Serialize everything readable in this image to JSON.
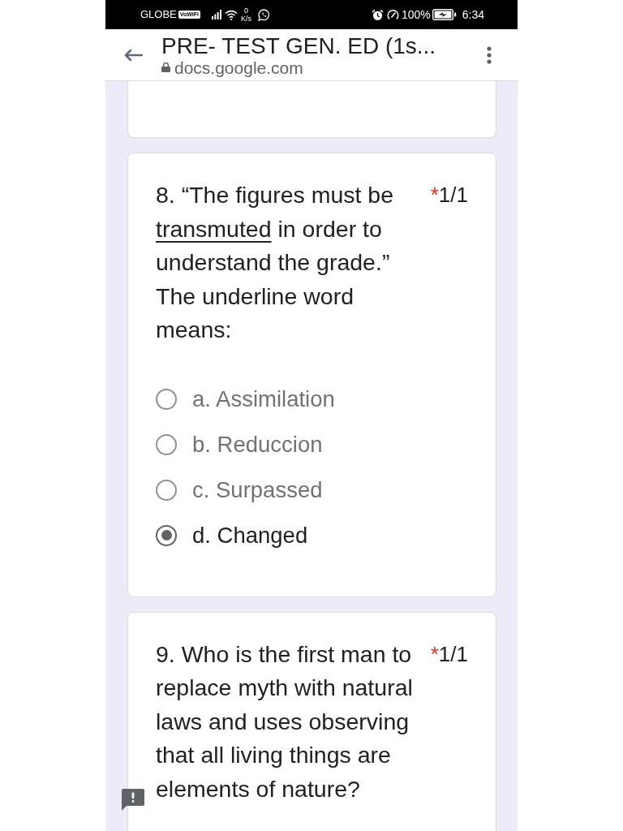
{
  "status_bar": {
    "carrier": "GLOBE",
    "network_badge": "VoWiFi",
    "data_rate_value": "0",
    "data_rate_unit": "K/s",
    "battery": "100%",
    "time": "6:34"
  },
  "header": {
    "title": "PRE- TEST GEN. ED (1s...",
    "url": "docs.google.com"
  },
  "questions": [
    {
      "text_parts": [
        {
          "text": "8. “The figures must be ",
          "underlined": false
        },
        {
          "text": "transmuted",
          "underlined": true
        },
        {
          "text": " in order to understand the grade.” The underline word means:",
          "underlined": false
        }
      ],
      "required_mark": "*",
      "score": "1/1",
      "options": [
        {
          "label": "a. Assimilation",
          "selected": false
        },
        {
          "label": "b. Reduccion",
          "selected": false
        },
        {
          "label": "c. Surpassed",
          "selected": false
        },
        {
          "label": "d. Changed",
          "selected": true
        }
      ]
    },
    {
      "text_parts": [
        {
          "text": "9. Who is the first man to replace myth with natural laws and uses observing that all living things are elements of nature?",
          "underlined": false
        }
      ],
      "required_mark": "*",
      "score": "1/1"
    }
  ]
}
